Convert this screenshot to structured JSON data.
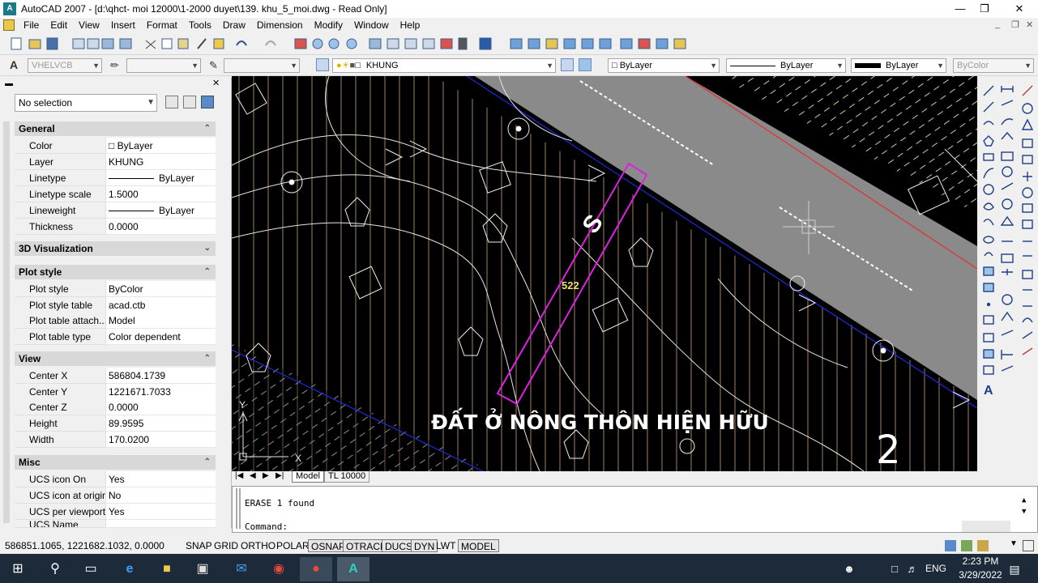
{
  "window": {
    "title": "AutoCAD 2007 - [d:\\qhct- moi 12000\\1-2000 duyet\\139. khu_5_moi.dwg - Read Only]",
    "app_icon": "A"
  },
  "menu": [
    "File",
    "Edit",
    "View",
    "Insert",
    "Format",
    "Tools",
    "Draw",
    "Dimension",
    "Modify",
    "Window",
    "Help"
  ],
  "styles_toolbar": {
    "text_style": "VHELVCB"
  },
  "layers_toolbar": {
    "current_layer": "KHUNG",
    "color": "ByLayer",
    "linetype": "ByLayer",
    "lineweight": "ByLayer",
    "plot_style": "ByColor"
  },
  "properties": {
    "selection": "No selection",
    "general": {
      "title": "General",
      "rows": [
        {
          "key": "Color",
          "value": "ByLayer"
        },
        {
          "key": "Layer",
          "value": "KHUNG"
        },
        {
          "key": "Linetype",
          "value": "ByLayer"
        },
        {
          "key": "Linetype scale",
          "value": "1.5000"
        },
        {
          "key": "Lineweight",
          "value": "ByLayer"
        },
        {
          "key": "Thickness",
          "value": "0.0000"
        }
      ]
    },
    "visualization": {
      "title": "3D Visualization"
    },
    "plot_style": {
      "title": "Plot style",
      "rows": [
        {
          "key": "Plot style",
          "value": "ByColor"
        },
        {
          "key": "Plot style table",
          "value": "acad.ctb"
        },
        {
          "key": "Plot table attach...",
          "value": "Model"
        },
        {
          "key": "Plot table type",
          "value": "Color dependent"
        }
      ]
    },
    "view": {
      "title": "View",
      "rows": [
        {
          "key": "Center X",
          "value": "586804.1739"
        },
        {
          "key": "Center Y",
          "value": "1221671.7033"
        },
        {
          "key": "Center Z",
          "value": "0.0000"
        },
        {
          "key": "Height",
          "value": "89.9595"
        },
        {
          "key": "Width",
          "value": "170.0200"
        }
      ]
    },
    "misc": {
      "title": "Misc",
      "rows": [
        {
          "key": "UCS icon On",
          "value": "Yes"
        },
        {
          "key": "UCS icon at origin",
          "value": "No"
        },
        {
          "key": "UCS per viewport",
          "value": "Yes"
        },
        {
          "key": "UCS Name",
          "value": ""
        }
      ]
    }
  },
  "drawing": {
    "label_main": "ĐẤT Ở NÔNG THÔN HIỆN HỮU",
    "label_lot": "522",
    "label_number": "2",
    "label_s": "S",
    "ucs_x": "X",
    "ucs_y": "Y"
  },
  "layout_tabs": [
    "Model",
    "TL 10000"
  ],
  "command": {
    "history": "ERASE 1 found",
    "prompt": "Command:"
  },
  "status_bar": {
    "coords": "586851.1065, 1221682.1032, 0.0000",
    "buttons": [
      "SNAP",
      "GRID",
      "ORTHO",
      "POLAR",
      "OSNAP",
      "OTRACK",
      "DUCS",
      "DYN",
      "LWT",
      "MODEL"
    ]
  },
  "taskbar": {
    "time": "2:23 PM",
    "date": "3/29/2022",
    "lang": "ENG"
  }
}
